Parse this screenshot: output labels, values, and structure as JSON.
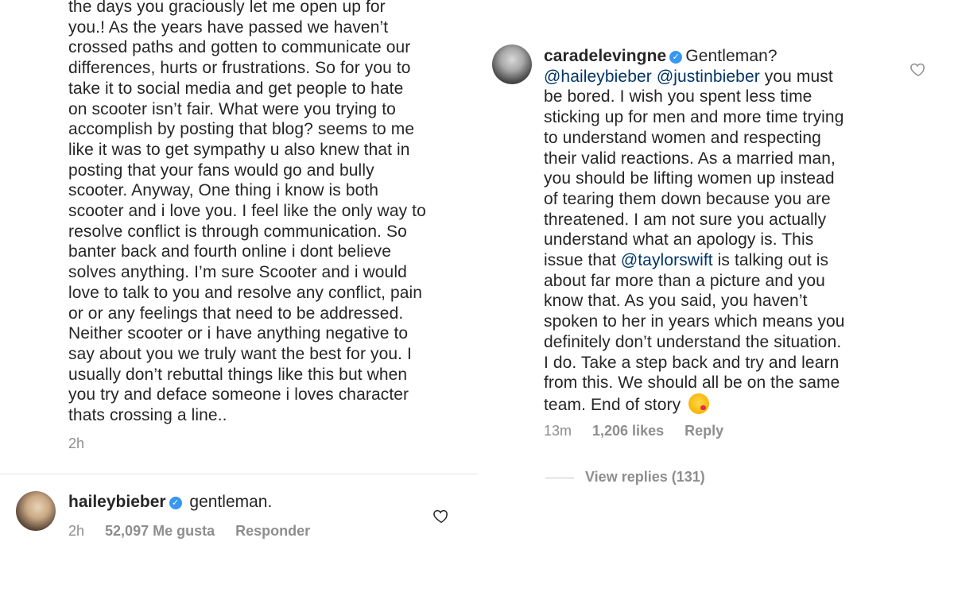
{
  "left": {
    "comment_body": "the days you graciously let me open up for\nyou.! As the years have passed we haven’t\ncrossed paths and gotten to communicate our\ndifferences, hurts or frustrations. So for you to\ntake it to social media and get people to hate\non scooter isn’t fair. What were you trying to\naccomplish by posting that blog? seems to me\nlike it was to get sympathy u also knew that in\nposting that your fans would go and bully\nscooter. Anyway, One thing i know is both\nscooter and i love you. I feel like the only way to\nresolve conflict is through communication. So\nbanter back and fourth online i dont believe\nsolves anything. I’m sure Scooter and i would\nlove to talk to you and resolve any conflict, pain\nor or any feelings that need to be addressed.\nNeither scooter or i  have anything negative to\nsay about you we truly want the best for you. I\nusually don’t rebuttal things like this but when\nyou try and deface someone i loves character\nthats crossing a line..",
    "comment_time": "2h",
    "reply": {
      "username": "haileybieber",
      "text": "gentleman.",
      "time": "2h",
      "likes": "52,097 Me gusta",
      "reply_label": "Responder"
    }
  },
  "right": {
    "comment": {
      "username": "caradelevingne",
      "text_intro": "Gentleman?",
      "mention_1": "@haileybieber",
      "mention_2": "@justinbieber",
      "text_a": " you must\nbe bored. I wish you spent less time\nsticking up for men and more time trying\nto understand women and respecting\ntheir valid reactions. As a married man,\nyou should be lifting women up instead\nof tearing them down because you are\nthreatened. I am not sure you actually\nunderstand what an apology is. This\nissue that ",
      "mention_3": "@taylorswift",
      "text_b": " is talking out is\nabout far more than a picture and you\nknow that. As you said, you haven’t\nspoken to her in years which means you\ndefinitely don’t understand the situation.\nI do. Take a step back and try and learn\nfrom this. We should all be on the same\nteam. End of story",
      "time": "13m",
      "likes": "1,206 likes",
      "reply_label": "Reply",
      "view_replies": "View replies (131)"
    }
  },
  "icons": {
    "verified": "verified-badge-icon",
    "heart": "heart-outline-icon",
    "emoji": "kiss-face-emoji"
  },
  "colors": {
    "text": "#262626",
    "meta": "#8e8e8e",
    "mention": "#003569",
    "verified": "#3897f0"
  }
}
